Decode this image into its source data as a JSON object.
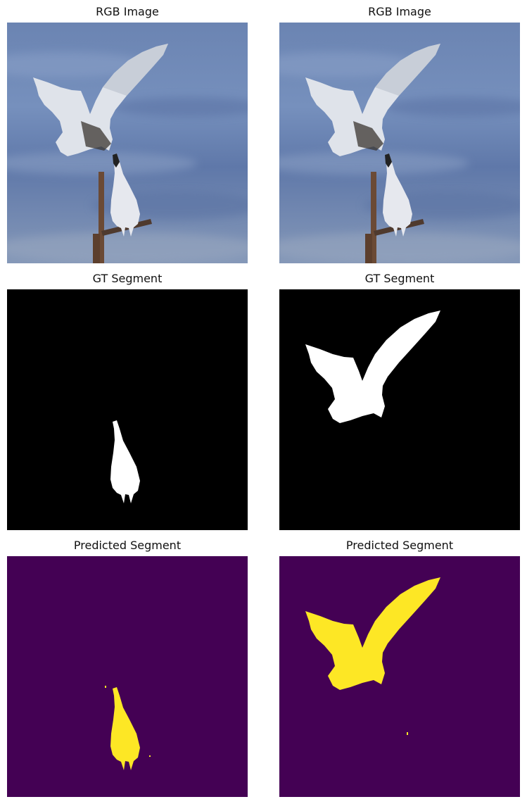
{
  "titles": {
    "rgb": "RGB Image",
    "gt": "GT Segment",
    "pred": "Predicted Segment"
  },
  "colors": {
    "water_light": "#6f86b4",
    "water_dark": "#4a6396",
    "mask_background": "#000000",
    "mask_foreground": "#ffffff",
    "pred_background": "#440154",
    "pred_foreground": "#fde725"
  }
}
